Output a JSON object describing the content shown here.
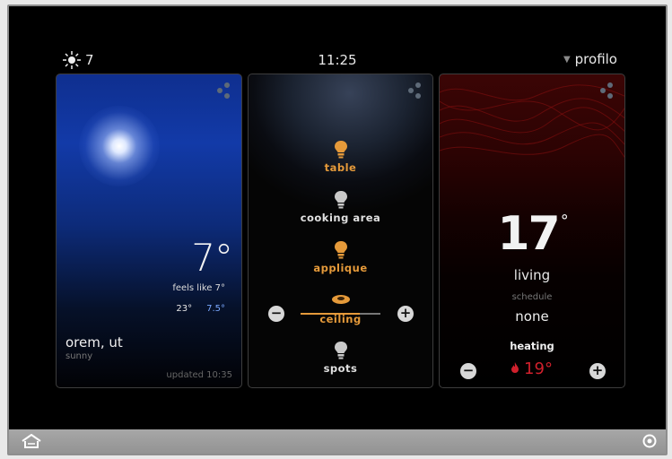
{
  "status": {
    "outdoor_temp": "7",
    "weather_icon": "sun-icon",
    "time": "11:25",
    "profile_label": "profilo"
  },
  "weather": {
    "temperature": "7°",
    "feels_like": "feels like 7°",
    "high": "23°",
    "low": "7.5°",
    "city": "orem, ut",
    "condition": "sunny",
    "updated": "updated 10:35"
  },
  "lights": {
    "items": [
      {
        "label": "table",
        "state": "on"
      },
      {
        "label": "cooking area",
        "state": "off"
      },
      {
        "label": "applique",
        "state": "on"
      },
      {
        "label": "ceiling",
        "state": "on",
        "dimmer_level": 0.74
      },
      {
        "label": "spots",
        "state": "off"
      }
    ],
    "minus_label": "−",
    "plus_label": "+"
  },
  "thermostat": {
    "temperature": "17",
    "degree": "°",
    "room": "living",
    "schedule_label": "schedule",
    "schedule_value": "none",
    "mode": "heating",
    "setpoint": "19°",
    "minus_label": "−",
    "plus_label": "+"
  },
  "colors": {
    "accent_on": "#e59a3a",
    "heating": "#d0202c",
    "weather_low": "#7aa8ff"
  }
}
